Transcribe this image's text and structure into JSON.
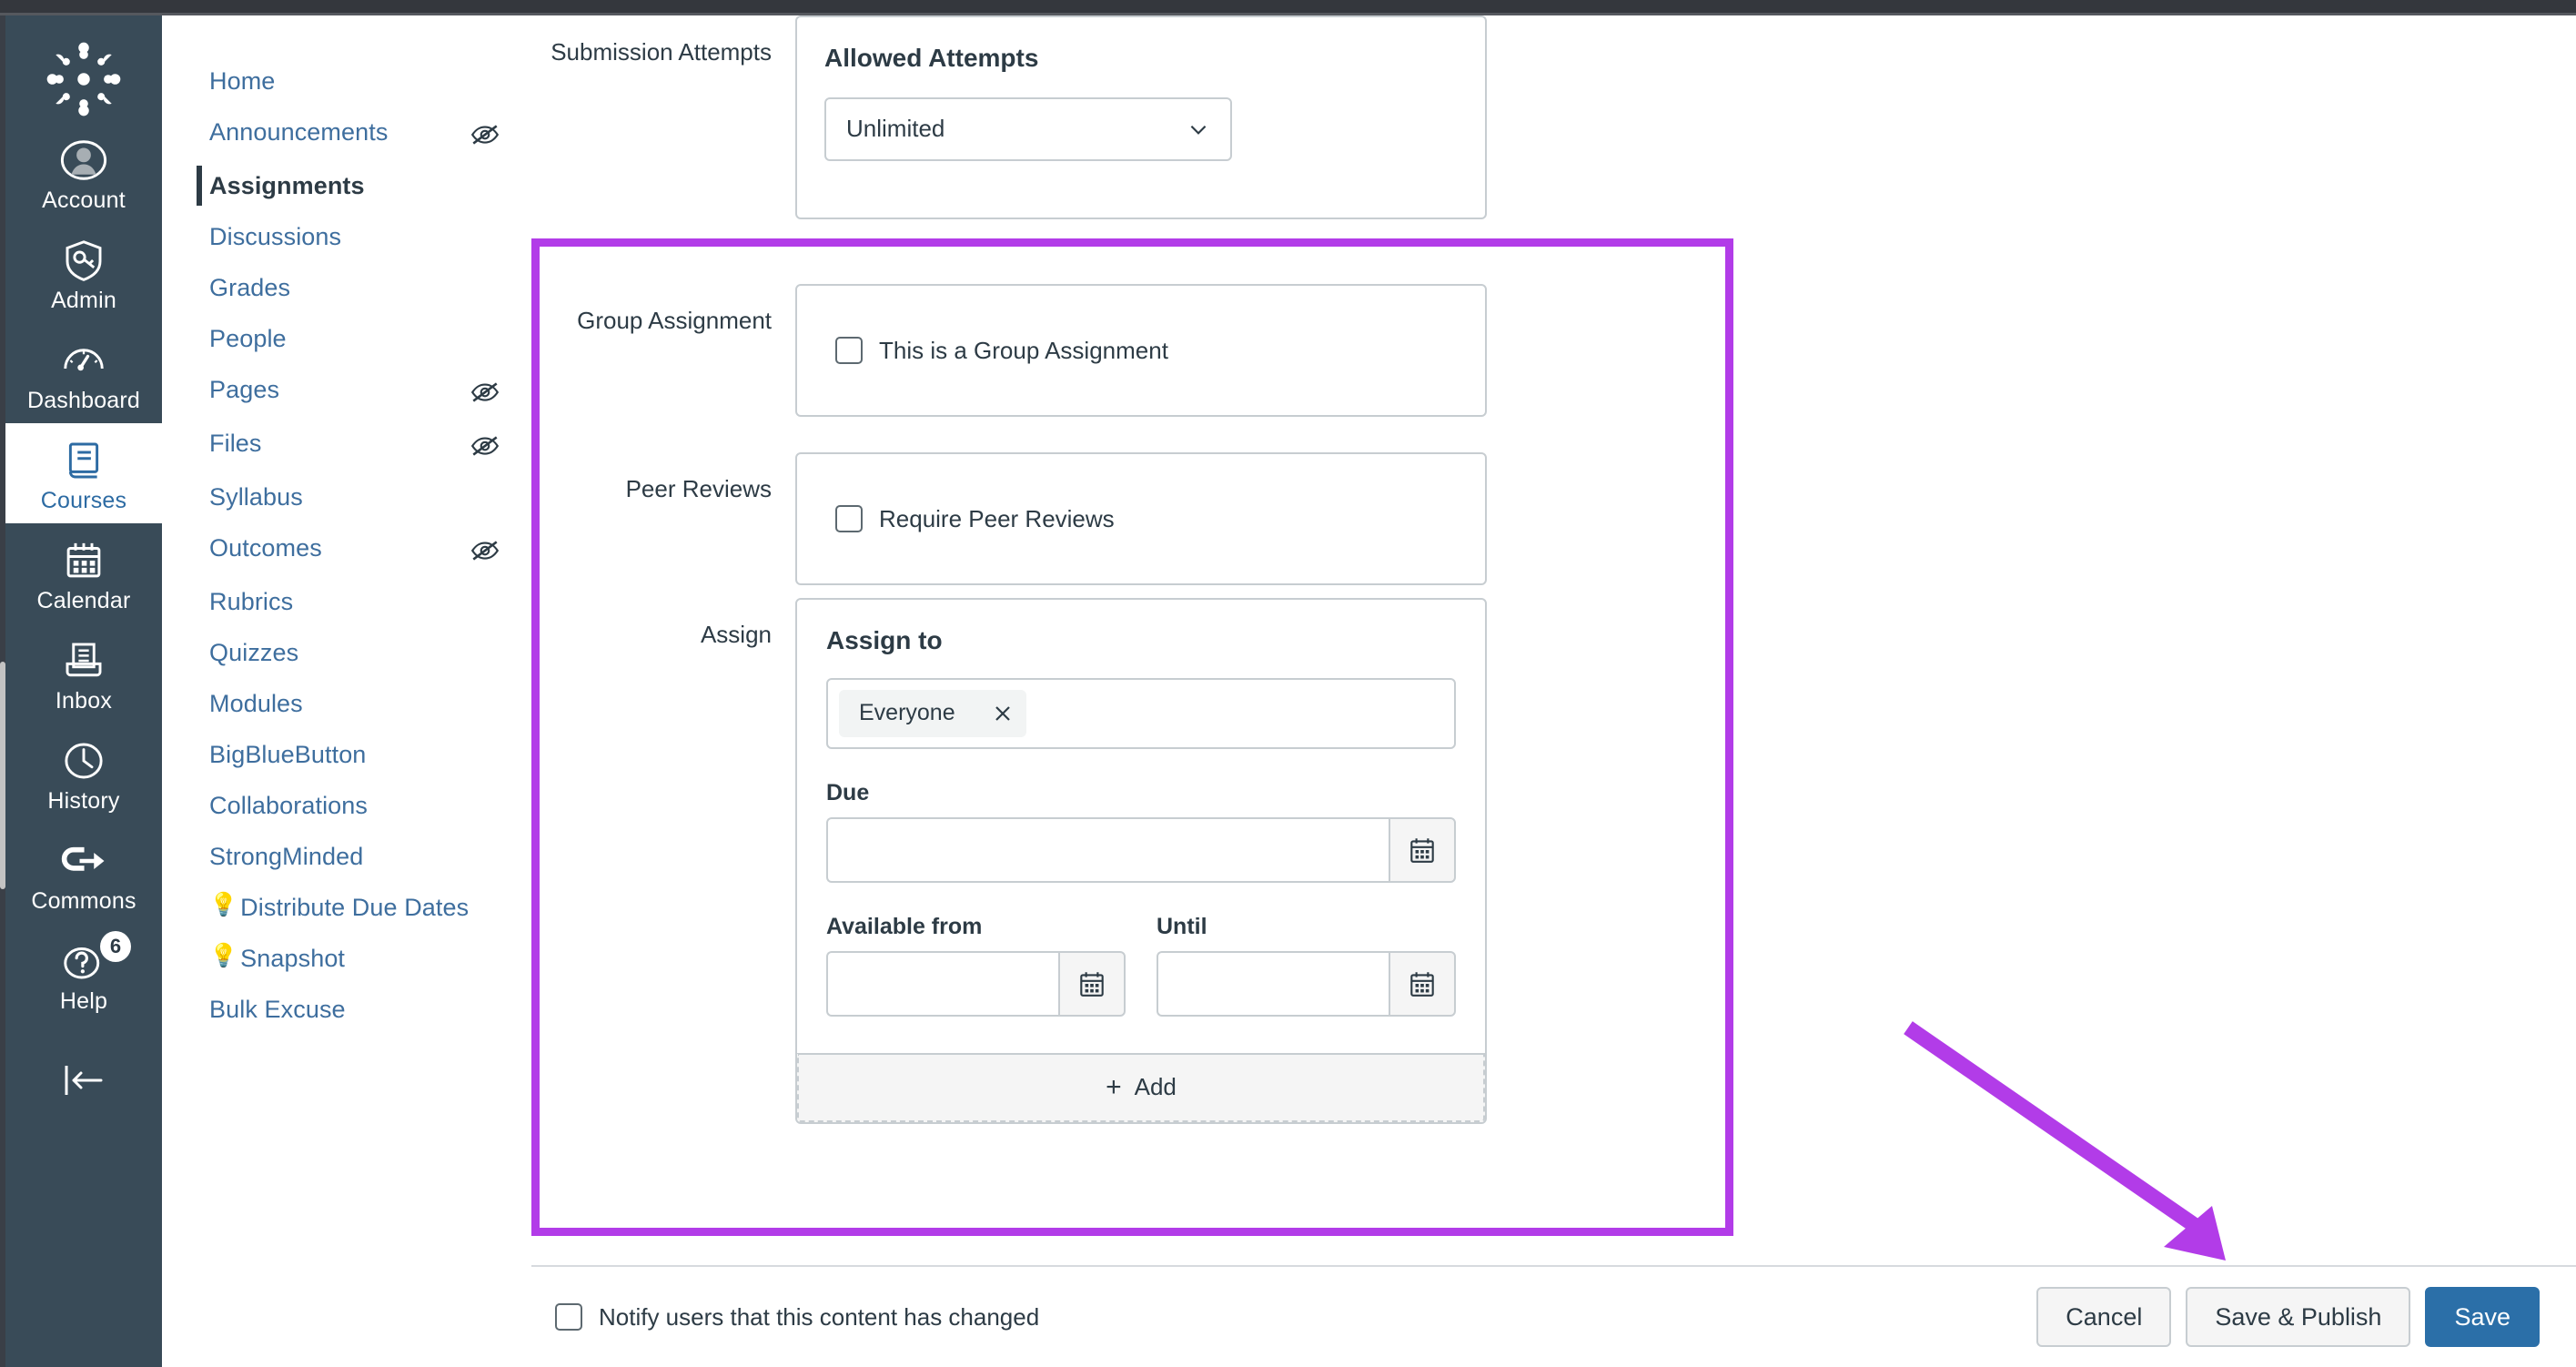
{
  "global_nav": {
    "logo_name": "canvas-logo",
    "items": [
      {
        "label": "Account",
        "icon": "user-circle-icon",
        "active": false,
        "badge": null
      },
      {
        "label": "Admin",
        "icon": "shield-key-icon",
        "active": false,
        "badge": null
      },
      {
        "label": "Dashboard",
        "icon": "gauge-icon",
        "active": false,
        "badge": null
      },
      {
        "label": "Courses",
        "icon": "book-icon",
        "active": true,
        "badge": null
      },
      {
        "label": "Calendar",
        "icon": "calendar-icon",
        "active": false,
        "badge": null
      },
      {
        "label": "Inbox",
        "icon": "inbox-tray-icon",
        "active": false,
        "badge": null
      },
      {
        "label": "History",
        "icon": "clock-icon",
        "active": false,
        "badge": null
      },
      {
        "label": "Commons",
        "icon": "commons-arrow-icon",
        "active": false,
        "badge": null
      },
      {
        "label": "Help",
        "icon": "question-circle-icon",
        "active": false,
        "badge": "6"
      }
    ],
    "collapse_label": "collapse-nav-icon"
  },
  "course_nav": {
    "items": [
      {
        "label": "Home",
        "active": false,
        "hidden_icon": false,
        "bulb": false
      },
      {
        "label": "Announcements",
        "active": false,
        "hidden_icon": true,
        "bulb": false
      },
      {
        "label": "Assignments",
        "active": true,
        "hidden_icon": false,
        "bulb": false
      },
      {
        "label": "Discussions",
        "active": false,
        "hidden_icon": false,
        "bulb": false
      },
      {
        "label": "Grades",
        "active": false,
        "hidden_icon": false,
        "bulb": false
      },
      {
        "label": "People",
        "active": false,
        "hidden_icon": false,
        "bulb": false
      },
      {
        "label": "Pages",
        "active": false,
        "hidden_icon": true,
        "bulb": false
      },
      {
        "label": "Files",
        "active": false,
        "hidden_icon": true,
        "bulb": false
      },
      {
        "label": "Syllabus",
        "active": false,
        "hidden_icon": false,
        "bulb": false
      },
      {
        "label": "Outcomes",
        "active": false,
        "hidden_icon": true,
        "bulb": false
      },
      {
        "label": "Rubrics",
        "active": false,
        "hidden_icon": false,
        "bulb": false
      },
      {
        "label": "Quizzes",
        "active": false,
        "hidden_icon": false,
        "bulb": false
      },
      {
        "label": "Modules",
        "active": false,
        "hidden_icon": false,
        "bulb": false
      },
      {
        "label": "BigBlueButton",
        "active": false,
        "hidden_icon": false,
        "bulb": false
      },
      {
        "label": "Collaborations",
        "active": false,
        "hidden_icon": false,
        "bulb": false
      },
      {
        "label": "StrongMinded",
        "active": false,
        "hidden_icon": false,
        "bulb": false
      },
      {
        "label": "Distribute Due Dates",
        "active": false,
        "hidden_icon": false,
        "bulb": true
      },
      {
        "label": "Snapshot",
        "active": false,
        "hidden_icon": false,
        "bulb": true
      },
      {
        "label": "Bulk Excuse",
        "active": false,
        "hidden_icon": false,
        "bulb": false
      }
    ]
  },
  "form": {
    "submission_attempts": {
      "row_label": "Submission Attempts",
      "panel_title": "Allowed Attempts",
      "select_value": "Unlimited",
      "select_icon": "chevron-down-icon"
    },
    "group_assignment": {
      "row_label": "Group Assignment",
      "checkbox_label": "This is a Group Assignment",
      "checked": false
    },
    "peer_reviews": {
      "row_label": "Peer Reviews",
      "checkbox_label": "Require Peer Reviews",
      "checked": false
    },
    "assign": {
      "row_label": "Assign",
      "panel_title": "Assign to",
      "pill_label": "Everyone",
      "pill_remove_icon": "close-x-icon",
      "due_label": "Due",
      "due_value": "",
      "available_from_label": "Available from",
      "available_from_value": "",
      "until_label": "Until",
      "until_value": "",
      "calendar_icon": "calendar-icon",
      "add_label": "Add",
      "add_icon": "plus-icon"
    }
  },
  "footer": {
    "notify_label": "Notify users that this content has changed",
    "notify_checked": false,
    "cancel_label": "Cancel",
    "save_publish_label": "Save & Publish",
    "save_label": "Save"
  },
  "annotations": {
    "highlight_color": "#B23CE8",
    "rect_name": "highlight-rectangle",
    "arrow_name": "pointer-arrow",
    "arrow_target": "Save & Publish"
  }
}
